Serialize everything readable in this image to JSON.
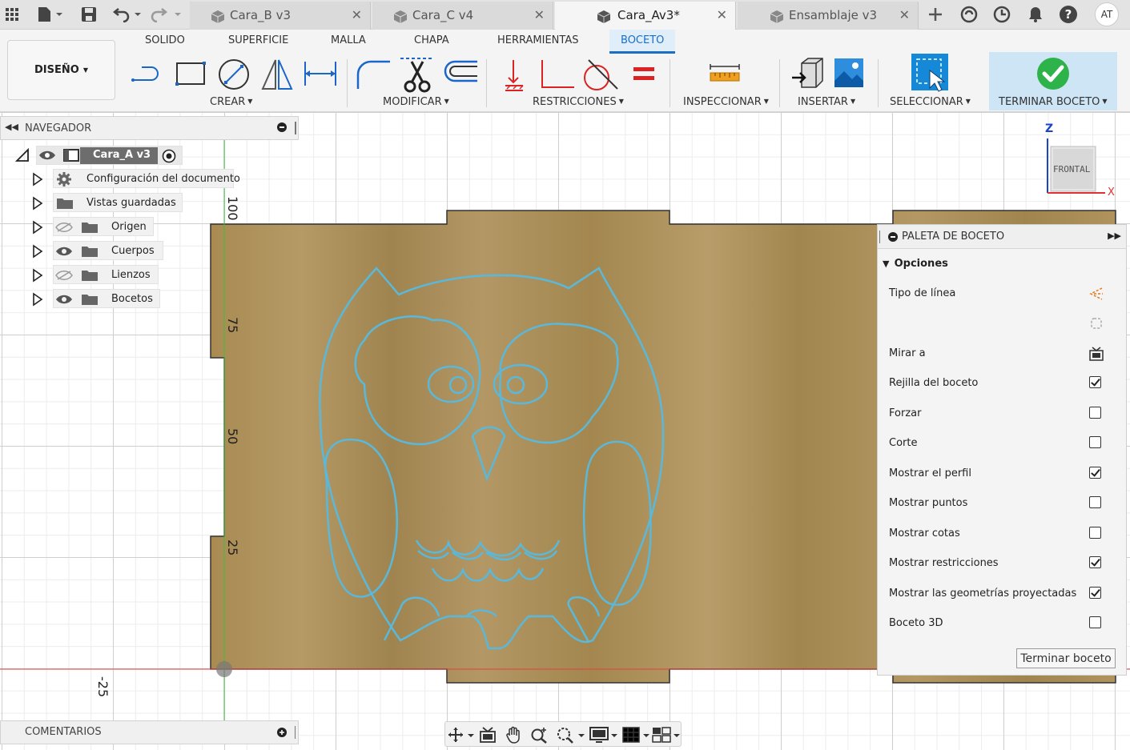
{
  "tabs": [
    {
      "label": "Cara_B v3",
      "active": false
    },
    {
      "label": "Cara_C v4",
      "active": false
    },
    {
      "label": "Cara_Av3*",
      "active": true
    },
    {
      "label": "Ensamblaje v3",
      "active": false
    }
  ],
  "user": {
    "initials": "AT"
  },
  "ribbon": {
    "tabs": [
      "SOLIDO",
      "SUPERFICIE",
      "MALLA",
      "CHAPA",
      "HERRAMIENTAS",
      "BOCETO"
    ],
    "active_tab": "BOCETO",
    "workspace": "DISEÑO",
    "groups": {
      "crear": "CREAR",
      "modificar": "MODIFICAR",
      "restricciones": "RESTRICCIONES",
      "inspeccionar": "INSPECCIONAR",
      "insertar": "INSERTAR",
      "seleccionar": "SELECCIONAR",
      "terminar": "TERMINAR BOCETO"
    }
  },
  "navigator": {
    "title": "NAVEGADOR",
    "root": "Cara_A v3",
    "items": [
      {
        "label": "Configuración del documento",
        "icon": "gear-icon"
      },
      {
        "label": "Vistas guardadas",
        "icon": "folder-icon"
      },
      {
        "label": "Origen",
        "icon": "folder-icon",
        "visible": false
      },
      {
        "label": "Cuerpos",
        "icon": "folder-icon",
        "visible": true
      },
      {
        "label": "Lienzos",
        "icon": "folder-icon",
        "visible": false
      },
      {
        "label": "Bocetos",
        "icon": "folder-icon",
        "visible": true
      }
    ]
  },
  "viewcube": {
    "face": "FRONTAL",
    "axis_z": "Z",
    "axis_x": "X"
  },
  "ruler": {
    "v100": "100",
    "v75": "75",
    "v50": "50",
    "v25": "25",
    "vneg25": "-25"
  },
  "palette": {
    "title": "PALETA DE BOCETO",
    "section": "Opciones",
    "options": [
      {
        "label": "Tipo de línea",
        "control": "icon"
      },
      {
        "label": "",
        "control": "icon"
      },
      {
        "label": "Mirar a",
        "control": "icon"
      },
      {
        "label": "Rejilla del boceto",
        "control": "checkbox",
        "checked": true
      },
      {
        "label": "Forzar",
        "control": "checkbox",
        "checked": false
      },
      {
        "label": "Corte",
        "control": "checkbox",
        "checked": false
      },
      {
        "label": "Mostrar el perfil",
        "control": "checkbox",
        "checked": true
      },
      {
        "label": "Mostrar puntos",
        "control": "checkbox",
        "checked": false
      },
      {
        "label": "Mostrar cotas",
        "control": "checkbox",
        "checked": false
      },
      {
        "label": "Mostrar restricciones",
        "control": "checkbox",
        "checked": true
      },
      {
        "label": "Mostrar las geometrías proyectadas",
        "control": "checkbox",
        "checked": true
      },
      {
        "label": "Boceto 3D",
        "control": "checkbox",
        "checked": false
      }
    ],
    "finish_button": "Terminar boceto"
  },
  "comments": {
    "title": "COMENTARIOS"
  },
  "colors": {
    "accent": "#1a6fc4",
    "wood": "#a88a55",
    "sketch_line": "#56b4d3",
    "finish_green": "#2db34a"
  }
}
